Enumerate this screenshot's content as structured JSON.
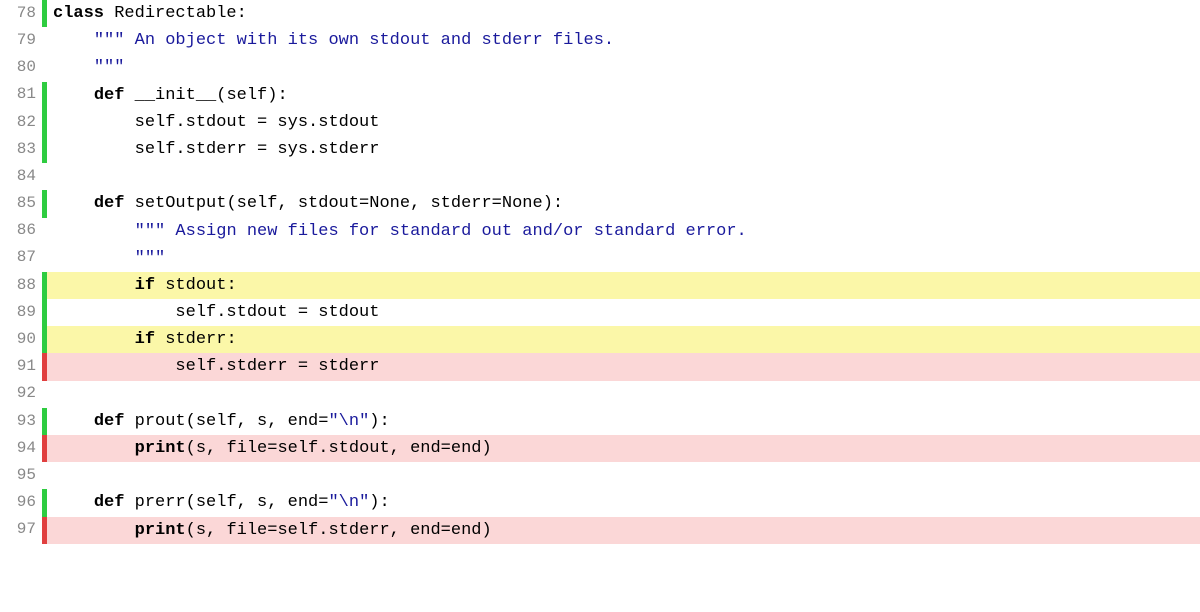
{
  "lines": [
    {
      "n": 78,
      "marker": "green",
      "hl": "",
      "tokens": [
        {
          "cls": "kw",
          "t": "class"
        },
        {
          "cls": "txt",
          "t": " Redirectable:"
        }
      ]
    },
    {
      "n": 79,
      "marker": "none",
      "hl": "",
      "tokens": [
        {
          "cls": "txt",
          "t": "    "
        },
        {
          "cls": "str",
          "t": "\"\"\" An object with its own stdout and stderr files."
        }
      ]
    },
    {
      "n": 80,
      "marker": "none",
      "hl": "",
      "tokens": [
        {
          "cls": "txt",
          "t": "    "
        },
        {
          "cls": "str",
          "t": "\"\"\""
        }
      ]
    },
    {
      "n": 81,
      "marker": "green",
      "hl": "",
      "tokens": [
        {
          "cls": "txt",
          "t": "    "
        },
        {
          "cls": "kw",
          "t": "def"
        },
        {
          "cls": "txt",
          "t": " __init__(self):"
        }
      ]
    },
    {
      "n": 82,
      "marker": "green",
      "hl": "",
      "tokens": [
        {
          "cls": "txt",
          "t": "        self.stdout = sys.stdout"
        }
      ]
    },
    {
      "n": 83,
      "marker": "green",
      "hl": "",
      "tokens": [
        {
          "cls": "txt",
          "t": "        self.stderr = sys.stderr"
        }
      ]
    },
    {
      "n": 84,
      "marker": "none",
      "hl": "",
      "tokens": [
        {
          "cls": "txt",
          "t": " "
        }
      ]
    },
    {
      "n": 85,
      "marker": "green",
      "hl": "",
      "tokens": [
        {
          "cls": "txt",
          "t": "    "
        },
        {
          "cls": "kw",
          "t": "def"
        },
        {
          "cls": "txt",
          "t": " setOutput(self, stdout=None, stderr=None):"
        }
      ]
    },
    {
      "n": 86,
      "marker": "none",
      "hl": "",
      "tokens": [
        {
          "cls": "txt",
          "t": "        "
        },
        {
          "cls": "str",
          "t": "\"\"\" Assign new files for standard out and/or standard error."
        }
      ]
    },
    {
      "n": 87,
      "marker": "none",
      "hl": "",
      "tokens": [
        {
          "cls": "txt",
          "t": "        "
        },
        {
          "cls": "str",
          "t": "\"\"\""
        }
      ]
    },
    {
      "n": 88,
      "marker": "green",
      "hl": "yellow",
      "tokens": [
        {
          "cls": "txt",
          "t": "        "
        },
        {
          "cls": "kw",
          "t": "if"
        },
        {
          "cls": "txt",
          "t": " stdout:"
        }
      ]
    },
    {
      "n": 89,
      "marker": "green",
      "hl": "",
      "tokens": [
        {
          "cls": "txt",
          "t": "            self.stdout = stdout"
        }
      ]
    },
    {
      "n": 90,
      "marker": "green",
      "hl": "yellow",
      "tokens": [
        {
          "cls": "txt",
          "t": "        "
        },
        {
          "cls": "kw",
          "t": "if"
        },
        {
          "cls": "txt",
          "t": " stderr:"
        }
      ]
    },
    {
      "n": 91,
      "marker": "red",
      "hl": "pink",
      "tokens": [
        {
          "cls": "txt",
          "t": "            self.stderr = stderr"
        }
      ]
    },
    {
      "n": 92,
      "marker": "none",
      "hl": "",
      "tokens": [
        {
          "cls": "txt",
          "t": " "
        }
      ]
    },
    {
      "n": 93,
      "marker": "green",
      "hl": "",
      "tokens": [
        {
          "cls": "txt",
          "t": "    "
        },
        {
          "cls": "kw",
          "t": "def"
        },
        {
          "cls": "txt",
          "t": " prout(self, s, end="
        },
        {
          "cls": "str",
          "t": "\"\\n\""
        },
        {
          "cls": "txt",
          "t": "):"
        }
      ]
    },
    {
      "n": 94,
      "marker": "red",
      "hl": "pink",
      "tokens": [
        {
          "cls": "txt",
          "t": "        "
        },
        {
          "cls": "kw",
          "t": "print"
        },
        {
          "cls": "txt",
          "t": "(s, file=self.stdout, end=end)"
        }
      ]
    },
    {
      "n": 95,
      "marker": "none",
      "hl": "",
      "tokens": [
        {
          "cls": "txt",
          "t": " "
        }
      ]
    },
    {
      "n": 96,
      "marker": "green",
      "hl": "",
      "tokens": [
        {
          "cls": "txt",
          "t": "    "
        },
        {
          "cls": "kw",
          "t": "def"
        },
        {
          "cls": "txt",
          "t": " prerr(self, s, end="
        },
        {
          "cls": "str",
          "t": "\"\\n\""
        },
        {
          "cls": "txt",
          "t": "):"
        }
      ]
    },
    {
      "n": 97,
      "marker": "red",
      "hl": "pink",
      "tokens": [
        {
          "cls": "txt",
          "t": "        "
        },
        {
          "cls": "kw",
          "t": "print"
        },
        {
          "cls": "txt",
          "t": "(s, file=self.stderr, end=end)"
        }
      ]
    }
  ]
}
